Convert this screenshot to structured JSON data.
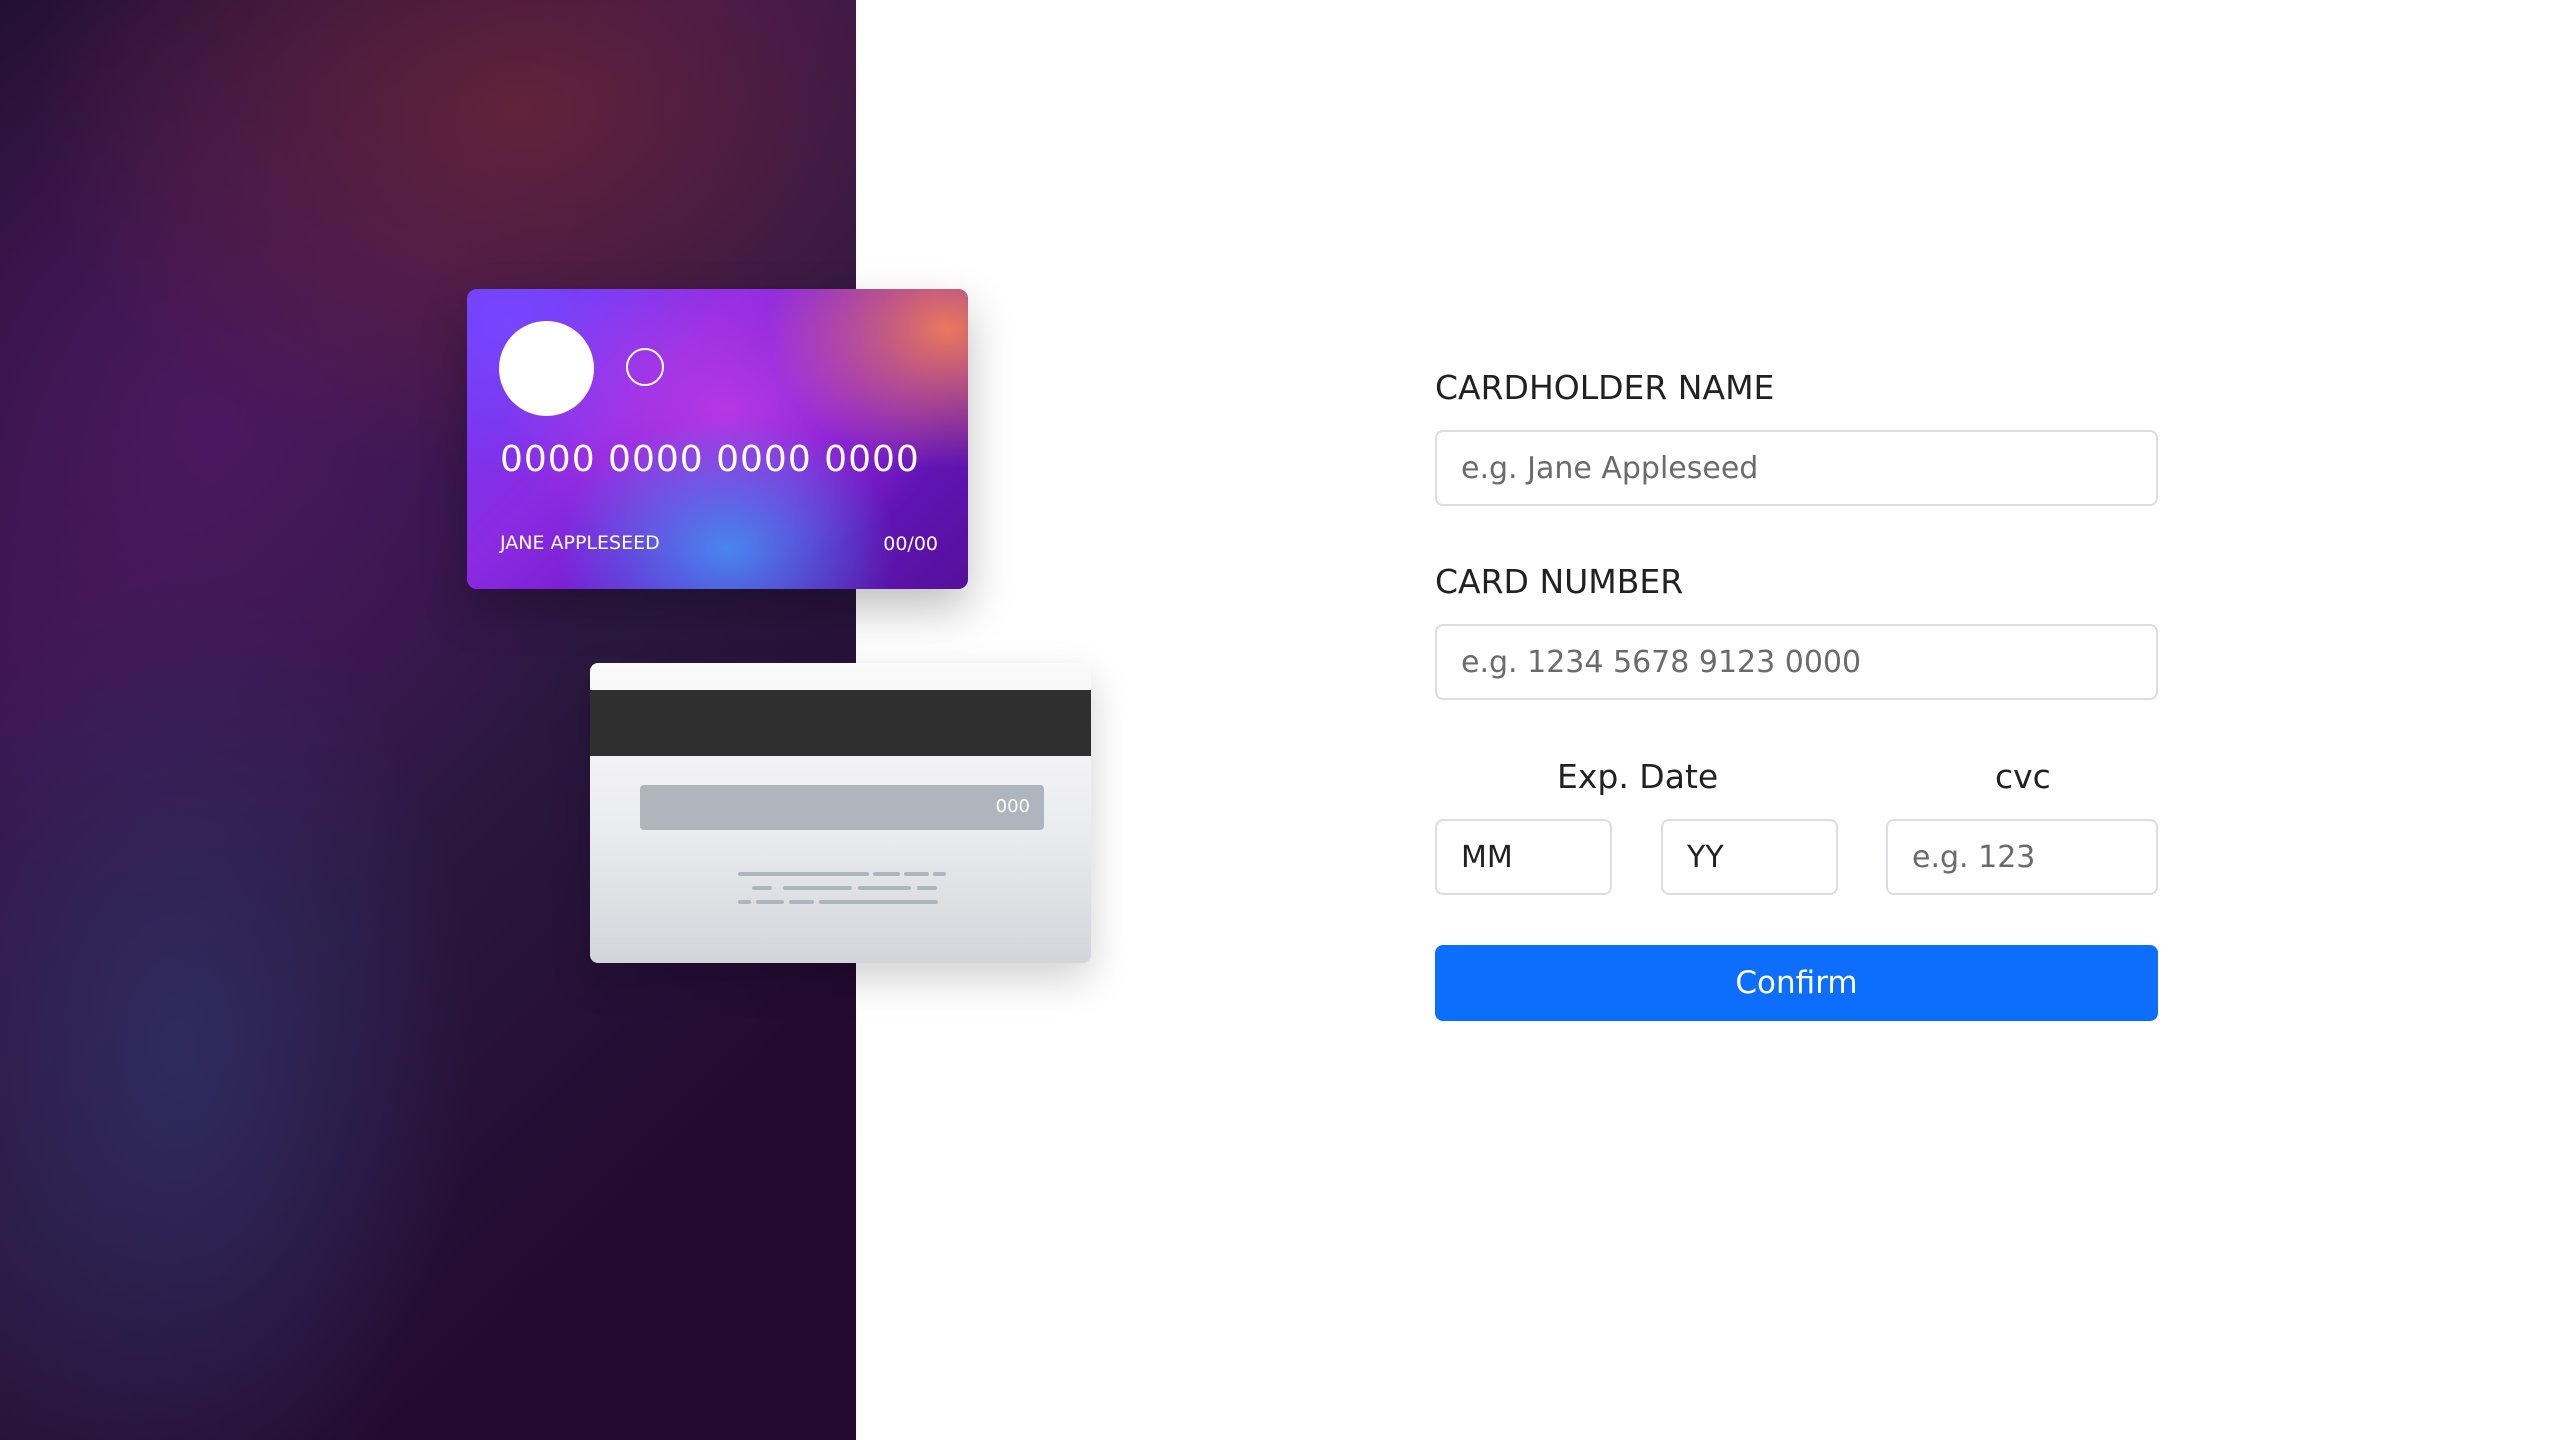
{
  "card_preview": {
    "front": {
      "number": "0000 0000 0000 0000",
      "holder": "JANE APPLESEED",
      "expiry": "00/00"
    },
    "back": {
      "cvc": "000"
    }
  },
  "form": {
    "cardholder_name": {
      "label": "CARDHOLDER NAME",
      "placeholder": "e.g. Jane Appleseed",
      "value": ""
    },
    "card_number": {
      "label": "CARD NUMBER",
      "placeholder": "e.g. 1234 5678 9123 0000",
      "value": ""
    },
    "exp_date": {
      "label": "Exp. Date",
      "month_placeholder": "MM",
      "year_placeholder": "YY"
    },
    "cvc": {
      "label": "cvc",
      "placeholder": "e.g. 123"
    },
    "confirm_label": "Confirm"
  },
  "colors": {
    "accent": "#0d6efd",
    "text": "#212121",
    "border": "#dcdde2",
    "card_gradient_start": "#6b3cf5",
    "card_gradient_end": "#55109a"
  }
}
